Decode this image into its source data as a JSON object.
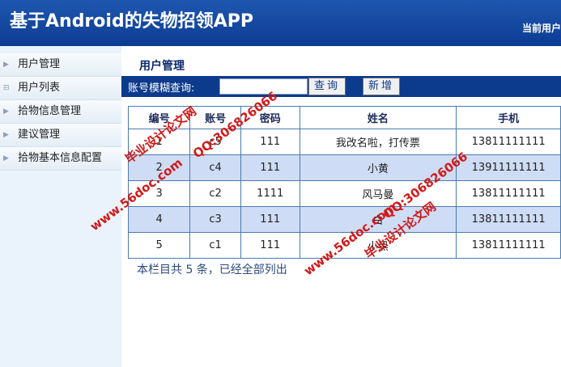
{
  "header": {
    "title": "基于Android的失物招领APP",
    "current_user": "当前用户"
  },
  "sidebar": {
    "items": [
      {
        "label": "用户管理",
        "icon": "collapse-icon"
      },
      {
        "label": "用户列表",
        "icon": "minus-icon"
      },
      {
        "label": "拾物信息管理",
        "icon": "collapse-icon"
      },
      {
        "label": "建议管理",
        "icon": "collapse-icon"
      },
      {
        "label": "拾物基本信息配置",
        "icon": "collapse-icon"
      }
    ]
  },
  "main": {
    "page_title": "用户管理",
    "search": {
      "label": "账号模糊查询:",
      "value": "",
      "search_button": "查询",
      "add_button": "新增"
    },
    "table": {
      "columns": [
        "编号",
        "账号",
        "密码",
        "姓名",
        "手机"
      ],
      "rows": [
        [
          "1",
          "c5",
          "111",
          "我改名啦，打传票",
          "13811111111"
        ],
        [
          "2",
          "c4",
          "111",
          "小黄",
          "13911111111"
        ],
        [
          "3",
          "c2",
          "1111",
          "风马曼",
          "13811111111"
        ],
        [
          "4",
          "c3",
          "111",
          "白",
          "13811111111"
        ],
        [
          "5",
          "c1",
          "111",
          "小黑",
          "13811111111"
        ]
      ]
    },
    "summary": "本栏目共 5 条，已经全部列出"
  },
  "watermarks": [
    "毕业设计论文网",
    "QQ:306826066",
    "www.56doc.com",
    "www.56doc.com",
    "QQ:306826066",
    "毕业设计论文网"
  ],
  "colors": {
    "header_bg": "#0d3c92",
    "searchbar_bg": "#0c3a8c",
    "alt_row_bg": "#cfdcf5",
    "watermark": "#d11919"
  }
}
